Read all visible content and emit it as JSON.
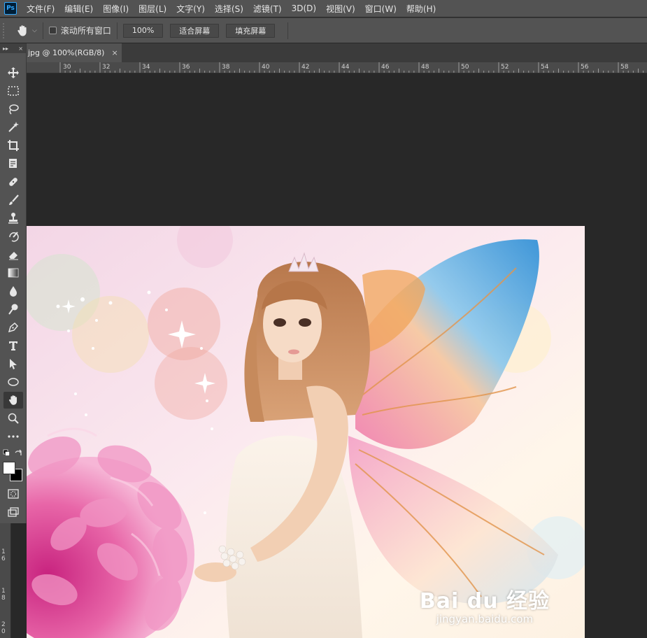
{
  "app": {
    "logo": "Ps",
    "menu": [
      "文件(F)",
      "编辑(E)",
      "图像(I)",
      "图层(L)",
      "文字(Y)",
      "选择(S)",
      "滤镜(T)",
      "3D(D)",
      "视图(V)",
      "窗口(W)",
      "帮助(H)"
    ]
  },
  "options": {
    "scroll_all_label": "滚动所有窗口",
    "zoom_value": "100%",
    "fit_screen_label": "适合屏幕",
    "fill_screen_label": "填充屏幕"
  },
  "document": {
    "tab_title": "jpg @ 100%(RGB/8)",
    "close_symbol": "×"
  },
  "ruler": {
    "top_labels": [
      "30",
      "32",
      "34",
      "36",
      "38",
      "40",
      "42",
      "44",
      "46",
      "48",
      "50",
      "52",
      "54",
      "56",
      "58"
    ],
    "left_labels": [
      "1",
      "6",
      "1",
      "8",
      "2",
      "0"
    ]
  },
  "toolbar": {
    "head_left": "▸▸",
    "head_right": "×",
    "tools": [
      "move-icon",
      "marquee-icon",
      "lasso-icon",
      "magic-wand-icon",
      "crop-icon",
      "eyedropper-icon",
      "healing-brush-icon",
      "brush-icon",
      "clone-stamp-icon",
      "history-brush-icon",
      "eraser-icon",
      "gradient-icon",
      "blur-icon",
      "dodge-icon",
      "pen-icon",
      "type-icon",
      "path-selection-icon",
      "ellipse-icon",
      "hand-icon",
      "zoom-icon",
      "more-tools-icon"
    ],
    "active_tool": "hand-icon"
  },
  "watermark": {
    "logo": "Bai du 经验",
    "url": "jingyan.baidu.com"
  },
  "colors": {
    "menubar": "#535353",
    "canvas_bg": "#282828",
    "foreground": "#ffffff",
    "background": "#000000"
  }
}
